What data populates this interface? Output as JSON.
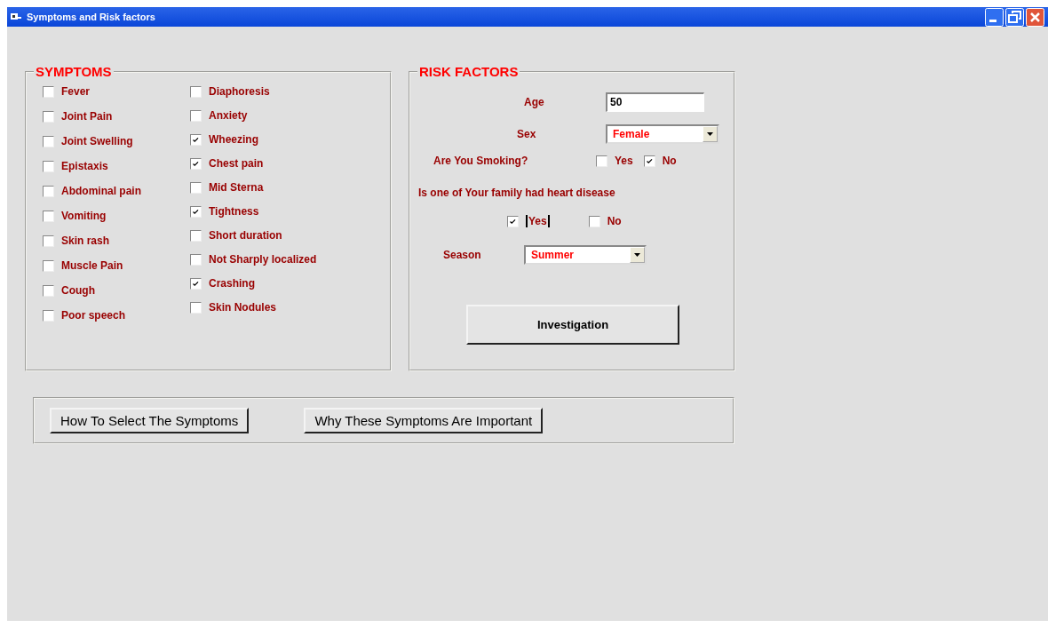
{
  "window": {
    "title": "Symptoms and Risk factors"
  },
  "symptoms": {
    "title": "SYMPTOMS",
    "columns": [
      [
        {
          "label": "Fever",
          "checked": false
        },
        {
          "label": "Joint Pain",
          "checked": false
        },
        {
          "label": "Joint Swelling",
          "checked": false
        },
        {
          "label": "Epistaxis",
          "checked": false
        },
        {
          "label": "Abdominal pain",
          "checked": false
        },
        {
          "label": "Vomiting",
          "checked": false
        },
        {
          "label": "Skin rash",
          "checked": false
        },
        {
          "label": "Muscle Pain",
          "checked": false
        },
        {
          "label": "Cough",
          "checked": false
        },
        {
          "label": "Poor speech",
          "checked": false
        }
      ],
      [
        {
          "label": "Diaphoresis",
          "checked": false
        },
        {
          "label": "Anxiety",
          "checked": false
        },
        {
          "label": "Wheezing",
          "checked": true
        },
        {
          "label": "Chest pain",
          "checked": true
        },
        {
          "label": "Mid Sterna",
          "checked": false
        },
        {
          "label": "Tightness",
          "checked": true
        },
        {
          "label": "Short duration",
          "checked": false
        },
        {
          "label": "Not Sharply localized",
          "checked": false
        },
        {
          "label": "Crashing",
          "checked": true
        },
        {
          "label": "Skin Nodules",
          "checked": false
        }
      ]
    ]
  },
  "risk_factors": {
    "title": "RISK FACTORS",
    "age": {
      "label": "Age",
      "value": "50"
    },
    "sex": {
      "label": "Sex",
      "value": "Female"
    },
    "smoking": {
      "label": "Are You Smoking?",
      "options": [
        {
          "label": "Yes",
          "checked": false
        },
        {
          "label": "No",
          "checked": true
        }
      ]
    },
    "family_history": {
      "label": "Is one of Your family had heart disease",
      "options": [
        {
          "label": "Yes",
          "checked": true
        },
        {
          "label": "No",
          "checked": false
        }
      ]
    },
    "season": {
      "label": "Season",
      "value": "Summer"
    },
    "investigation_button": "Investigation"
  },
  "help_buttons": [
    "How To Select The Symptoms",
    "Why These Symptoms Are Important"
  ]
}
